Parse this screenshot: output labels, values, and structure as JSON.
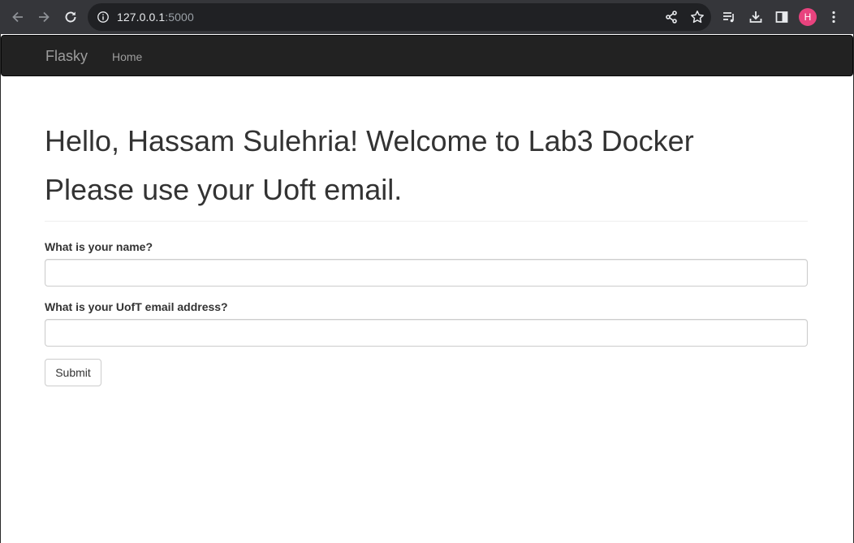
{
  "browser": {
    "url_host": "127.0.0.1",
    "url_port": ":5000",
    "profile_initial": "H",
    "profile_color": "#e8437e"
  },
  "navbar": {
    "brand": "Flasky",
    "links": [
      {
        "label": "Home"
      }
    ]
  },
  "page": {
    "greeting": "Hello, Hassam Sulehria! Welcome to Lab3 Docker",
    "instruction": "Please use your Uoft email."
  },
  "form": {
    "name_label": "What is your name?",
    "name_value": "",
    "email_label": "What is your UofT email address?",
    "email_value": "",
    "submit_label": "Submit"
  },
  "icons": {
    "back": "arrow-left-icon",
    "forward": "arrow-right-icon",
    "reload": "reload-icon",
    "info": "info-icon",
    "share": "share-icon",
    "bookmark": "star-icon",
    "reading_list": "reading-list-icon",
    "downloads": "download-icon",
    "side_panel": "side-panel-icon",
    "menu": "kebab-menu-icon"
  }
}
